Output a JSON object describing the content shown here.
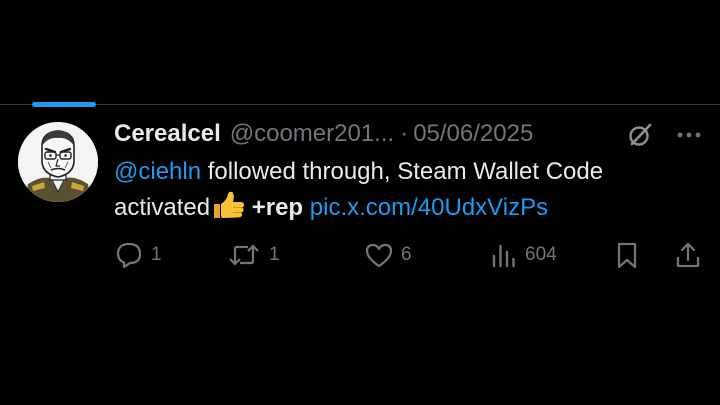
{
  "tweet": {
    "display_name": "Cerealcel",
    "handle": "@coomer201...",
    "separator": "·",
    "date": "05/06/2025",
    "text": {
      "mention": "@ciehln",
      "body": " followed through, Steam Wallet Code activated",
      "rep": " +rep ",
      "link": "pic.x.com/40UdxVizPs"
    },
    "emoji": "thumbs-up",
    "stats": {
      "replies": "1",
      "reposts": "1",
      "likes": "6",
      "views": "604"
    }
  },
  "colors": {
    "background": "#000000",
    "primary_text": "#e7e9ea",
    "secondary_text": "#71767b",
    "accent": "#1d9bf0",
    "divider": "#2f3336"
  },
  "icons": {
    "header": [
      "grok-icon",
      "more-icon"
    ],
    "actions": [
      "reply-icon",
      "repost-icon",
      "like-icon",
      "views-icon",
      "bookmark-icon",
      "share-icon"
    ]
  }
}
